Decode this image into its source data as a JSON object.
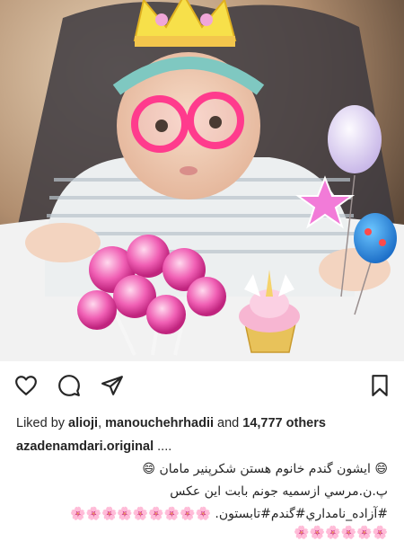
{
  "post": {
    "likes_prefix": "Liked by ",
    "liker1": "alioji",
    "separator": ", ",
    "liker2": "manouchehrhadii",
    "and_text": " and ",
    "others": "14,777 others",
    "username": "azadenamdari.original",
    "more": " ....",
    "caption_line1": "😄 ایشون گندم خانوم هستن شکرپنیر مامان 😄",
    "caption_line2": "پ.ن.مرسي ازسميه جونم بابت اين عكس",
    "caption_line3": "#آزاده_نامداري#گندم#تابستون. 🌸🌸🌸🌸🌸🌸🌸🌸🌸",
    "caption_line4": "🌸🌸🌸🌸🌸🌸"
  },
  "icons": {
    "like": "heart-icon",
    "comment": "comment-icon",
    "share": "paper-plane-icon",
    "save": "bookmark-icon"
  },
  "colors": {
    "text": "#262626",
    "glasses": "#ff3b8d",
    "crown": "#f7e04a"
  }
}
